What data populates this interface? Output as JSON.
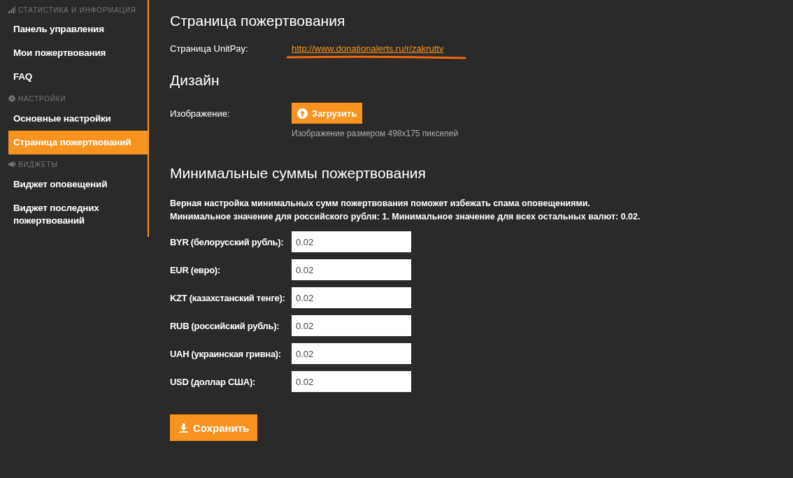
{
  "sidebar": {
    "sections": [
      {
        "title": "СТАТИСТИКА И ИНФОРМАЦИЯ",
        "kind": "stats",
        "items": [
          {
            "label": "Панель управления",
            "selected": false
          },
          {
            "label": "Мои пожертвования",
            "selected": false
          },
          {
            "label": "FAQ",
            "selected": false
          }
        ]
      },
      {
        "title": "НАСТРОЙКИ",
        "kind": "settings",
        "items": [
          {
            "label": "Основные настройки",
            "selected": false
          },
          {
            "label": "Страница пожертвований",
            "selected": true
          }
        ]
      },
      {
        "title": "ВИДЖЕТЫ",
        "kind": "widgets",
        "items": [
          {
            "label": "Виджет оповещений",
            "selected": false
          },
          {
            "label": "Виджет последних пожертвований",
            "selected": false
          }
        ]
      }
    ]
  },
  "donation_page": {
    "heading": "Страница пожертвования",
    "label": "Страница UnitPay:",
    "link": "http://www.donationalerts.ru/r/zakruttv",
    "underlined": true
  },
  "design": {
    "heading": "Дизайн",
    "label": "Изображение:",
    "upload_button": "Загрузить",
    "hint": "Изображение размером 498x175 пикселей"
  },
  "minimums": {
    "heading": "Минимальные суммы пожертвования",
    "description": [
      "Верная настройка минимальных сумм пожертвования поможет избежать спама оповещениями.",
      "Минимальное значение для российского рубля: 1. Минимальное значение для всех остальных валют: 0.02."
    ],
    "fields": [
      {
        "label": "BYR (белорусский рубль):",
        "value": "0.02"
      },
      {
        "label": "EUR (евро):",
        "value": "0.02"
      },
      {
        "label": "KZT (казахстанский тенге):",
        "value": "0.02"
      },
      {
        "label": "RUB (российский рубль):",
        "value": "0.02"
      },
      {
        "label": "UAH (украинская гривна):",
        "value": "0.02"
      },
      {
        "label": "USD (доллар США):",
        "value": "0.02"
      }
    ]
  },
  "save_button": "Сохранить"
}
